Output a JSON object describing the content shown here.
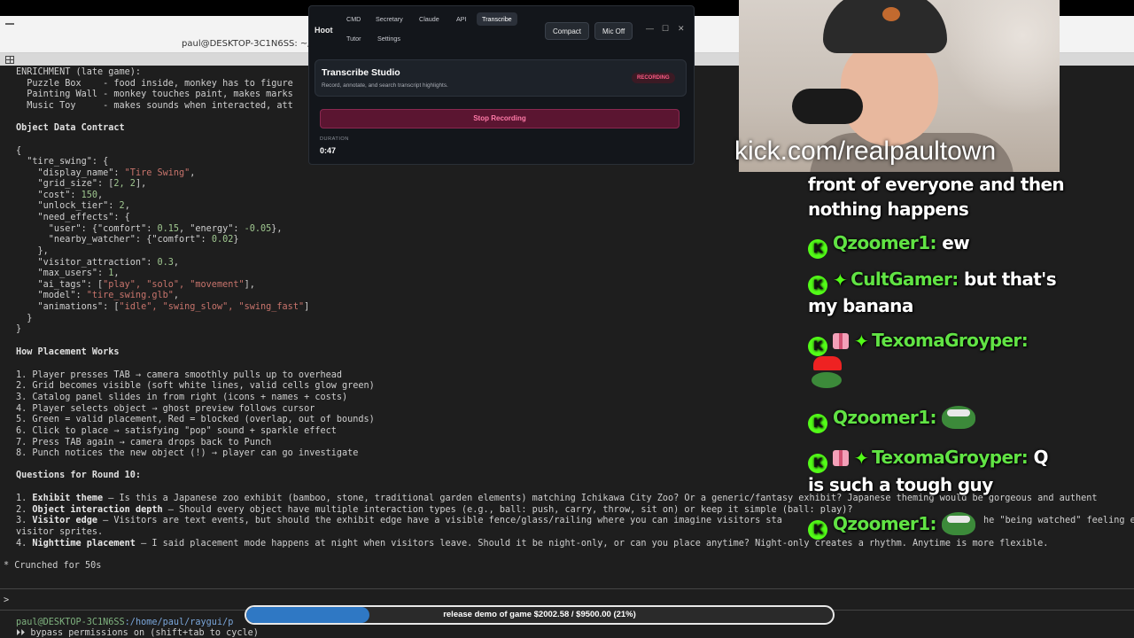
{
  "terminal": {
    "window_title": "paul@DESKTOP-3C1N6SS: ~/ra",
    "enrichment_header": "ENRICHMENT (late game):",
    "enrichment_items": [
      {
        "name": "  Puzzle Box    ",
        "desc": "- food inside, monkey has to figure"
      },
      {
        "name": "  Painting Wall ",
        "desc": "- monkey touches paint, makes marks"
      },
      {
        "name": "  Music Toy     ",
        "desc": "- makes sounds when interacted, att"
      }
    ],
    "contract_header": "Object Data Contract",
    "code": {
      "open": "{",
      "key": "  \"tire_swing\": {",
      "display_name_k": "    \"display_name\": ",
      "display_name_v": "\"Tire Swing\"",
      "grid_size_k": "    \"grid_size\": [",
      "grid_size_v": "2, 2",
      "cost_k": "    \"cost\": ",
      "cost_v": "150",
      "unlock_k": "    \"unlock_tier\": ",
      "unlock_v": "2",
      "need_effects": "    \"need_effects\": {",
      "user_line_a": "      \"user\": {\"comfort\": ",
      "user_v1": "0.15",
      "user_line_b": ", \"energy\": ",
      "user_v2": "-0.05",
      "user_line_c": "},",
      "nearby_a": "      \"nearby_watcher\": {\"comfort\": ",
      "nearby_v": "0.02",
      "nearby_b": "}",
      "close_inner": "    },",
      "visitor_k": "    \"visitor_attraction\": ",
      "visitor_v": "0.3",
      "max_users_k": "    \"max_users\": ",
      "max_users_v": "1",
      "ai_tags_k": "    \"ai_tags\": [",
      "ai_tags_v": "\"play\", \"solo\", \"movement\"",
      "model_k": "    \"model\": ",
      "model_v": "\"tire_swing.glb\"",
      "anim_k": "    \"animations\": [",
      "anim_v": "\"idle\", \"swing_slow\", \"swing_fast\"",
      "close_obj": "  }",
      "close": "}"
    },
    "placement_header": "How Placement Works",
    "placement_steps": [
      "1. Player presses TAB → camera smoothly pulls up to overhead",
      "2. Grid becomes visible (soft white lines, valid cells glow green)",
      "3. Catalog panel slides in from right (icons + names + costs)",
      "4. Player selects object → ghost preview follows cursor",
      "5. Green = valid placement, Red = blocked (overlap, out of bounds)",
      "6. Click to place → satisfying \"pop\" sound + sparkle effect",
      "7. Press TAB again → camera drops back to Punch",
      "8. Punch notices the new object (!) → player can go investigate"
    ],
    "questions_header": "Questions for Round 10:",
    "questions": [
      {
        "num": "1. ",
        "bold": "Exhibit theme",
        "text": " — Is this a Japanese zoo exhibit (bamboo, stone, traditional garden elements) matching Ichikawa City Zoo? Or a generic/fantasy exhibit? Japanese theming would be gorgeous and authent"
      },
      {
        "num": "2. ",
        "bold": "Object interaction depth",
        "text": " — Should every object have multiple interaction types (e.g., ball: push, carry, throw, sit on) or keep it simple (ball: play)?"
      },
      {
        "num": "3. ",
        "bold": "Visitor edge",
        "text": " — Visitors are text events, but should the exhibit edge have a visible fence/glass/railing where you can imagine visitors sta"
      },
      {
        "num": "",
        "bold": "",
        "text": "visitor sprites."
      },
      {
        "num": "4. ",
        "bold": "Nighttime placement",
        "text": " — I said placement mode happens at night when visitors leave. Should it be night-only, or can you place anytime? Night-only creates a rhythm. Anytime is more flexible."
      }
    ],
    "q3_tail": "he \"being watched\" feeling even witho",
    "crunched": "* Crunched for 50s",
    "prompt_caret": ">",
    "prompt_user": "paul@DESKTOP-3C1N6SS",
    "prompt_path": ":/home/paul/raygui/p",
    "bypass": "⏵⏵ bypass permissions on (shift+tab to cycle)"
  },
  "hoot": {
    "brand": "Hoot",
    "tabs_row1": [
      "CMD",
      "Secretary",
      "Claude",
      "API",
      "Transcribe"
    ],
    "tabs_row2": [
      "Tutor",
      "Settings"
    ],
    "active_tab": "Transcribe",
    "compact_label": "Compact",
    "mic_label": "Mic Off",
    "card_title": "Transcribe Studio",
    "card_subtitle": "Record, annotate, and search transcript highlights.",
    "status_badge": "RECORDING",
    "stop_label": "Stop Recording",
    "duration_label": "DURATION",
    "duration_value": "0:47",
    "win_min": "—",
    "win_max": "☐",
    "win_close": "✕"
  },
  "stream": {
    "url": "kick.com/realpaultown",
    "chat": [
      {
        "text1": "front of everyone and then"
      },
      {
        "text1": "nothing happens"
      },
      {
        "user": "Qzoomer1:",
        "msg": " ew"
      },
      {
        "user": "CultGamer:",
        "msg": " but that's"
      },
      {
        "text1": "my banana"
      },
      {
        "user": "TexomaGroyper:",
        "msg": ""
      },
      {
        "user": "Qzoomer1:",
        "msg": ""
      },
      {
        "user": "TexomaGroyper:",
        "msg": " Q"
      },
      {
        "text1": "is such a tough guy"
      },
      {
        "user": "Qzoomer1:",
        "msg": ""
      }
    ],
    "goal": {
      "text": "release demo of game $2002.58 / $9500.00 (21%)",
      "progress": 0.21
    },
    "colors": {
      "username": "#61e344",
      "kick_green": "#53fc18",
      "goal_fill": "#2f78c4",
      "recording_red": "#ff5b86"
    }
  }
}
